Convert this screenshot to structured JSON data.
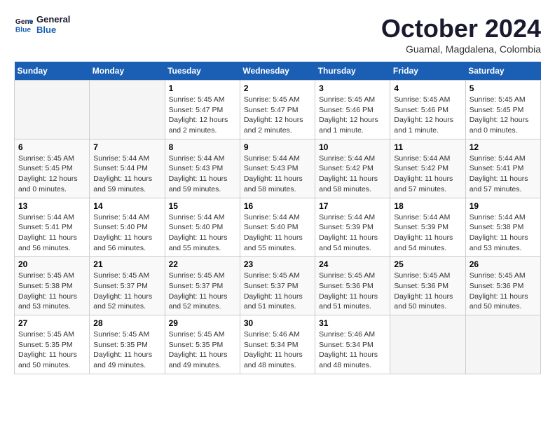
{
  "logo": {
    "line1": "General",
    "line2": "Blue"
  },
  "title": "October 2024",
  "location": "Guamal, Magdalena, Colombia",
  "days_of_week": [
    "Sunday",
    "Monday",
    "Tuesday",
    "Wednesday",
    "Thursday",
    "Friday",
    "Saturday"
  ],
  "weeks": [
    [
      {
        "day": "",
        "info": ""
      },
      {
        "day": "",
        "info": ""
      },
      {
        "day": "1",
        "info": "Sunrise: 5:45 AM\nSunset: 5:47 PM\nDaylight: 12 hours\nand 2 minutes."
      },
      {
        "day": "2",
        "info": "Sunrise: 5:45 AM\nSunset: 5:47 PM\nDaylight: 12 hours\nand 2 minutes."
      },
      {
        "day": "3",
        "info": "Sunrise: 5:45 AM\nSunset: 5:46 PM\nDaylight: 12 hours\nand 1 minute."
      },
      {
        "day": "4",
        "info": "Sunrise: 5:45 AM\nSunset: 5:46 PM\nDaylight: 12 hours\nand 1 minute."
      },
      {
        "day": "5",
        "info": "Sunrise: 5:45 AM\nSunset: 5:45 PM\nDaylight: 12 hours\nand 0 minutes."
      }
    ],
    [
      {
        "day": "6",
        "info": "Sunrise: 5:45 AM\nSunset: 5:45 PM\nDaylight: 12 hours\nand 0 minutes."
      },
      {
        "day": "7",
        "info": "Sunrise: 5:44 AM\nSunset: 5:44 PM\nDaylight: 11 hours\nand 59 minutes."
      },
      {
        "day": "8",
        "info": "Sunrise: 5:44 AM\nSunset: 5:43 PM\nDaylight: 11 hours\nand 59 minutes."
      },
      {
        "day": "9",
        "info": "Sunrise: 5:44 AM\nSunset: 5:43 PM\nDaylight: 11 hours\nand 58 minutes."
      },
      {
        "day": "10",
        "info": "Sunrise: 5:44 AM\nSunset: 5:42 PM\nDaylight: 11 hours\nand 58 minutes."
      },
      {
        "day": "11",
        "info": "Sunrise: 5:44 AM\nSunset: 5:42 PM\nDaylight: 11 hours\nand 57 minutes."
      },
      {
        "day": "12",
        "info": "Sunrise: 5:44 AM\nSunset: 5:41 PM\nDaylight: 11 hours\nand 57 minutes."
      }
    ],
    [
      {
        "day": "13",
        "info": "Sunrise: 5:44 AM\nSunset: 5:41 PM\nDaylight: 11 hours\nand 56 minutes."
      },
      {
        "day": "14",
        "info": "Sunrise: 5:44 AM\nSunset: 5:40 PM\nDaylight: 11 hours\nand 56 minutes."
      },
      {
        "day": "15",
        "info": "Sunrise: 5:44 AM\nSunset: 5:40 PM\nDaylight: 11 hours\nand 55 minutes."
      },
      {
        "day": "16",
        "info": "Sunrise: 5:44 AM\nSunset: 5:40 PM\nDaylight: 11 hours\nand 55 minutes."
      },
      {
        "day": "17",
        "info": "Sunrise: 5:44 AM\nSunset: 5:39 PM\nDaylight: 11 hours\nand 54 minutes."
      },
      {
        "day": "18",
        "info": "Sunrise: 5:44 AM\nSunset: 5:39 PM\nDaylight: 11 hours\nand 54 minutes."
      },
      {
        "day": "19",
        "info": "Sunrise: 5:44 AM\nSunset: 5:38 PM\nDaylight: 11 hours\nand 53 minutes."
      }
    ],
    [
      {
        "day": "20",
        "info": "Sunrise: 5:45 AM\nSunset: 5:38 PM\nDaylight: 11 hours\nand 53 minutes."
      },
      {
        "day": "21",
        "info": "Sunrise: 5:45 AM\nSunset: 5:37 PM\nDaylight: 11 hours\nand 52 minutes."
      },
      {
        "day": "22",
        "info": "Sunrise: 5:45 AM\nSunset: 5:37 PM\nDaylight: 11 hours\nand 52 minutes."
      },
      {
        "day": "23",
        "info": "Sunrise: 5:45 AM\nSunset: 5:37 PM\nDaylight: 11 hours\nand 51 minutes."
      },
      {
        "day": "24",
        "info": "Sunrise: 5:45 AM\nSunset: 5:36 PM\nDaylight: 11 hours\nand 51 minutes."
      },
      {
        "day": "25",
        "info": "Sunrise: 5:45 AM\nSunset: 5:36 PM\nDaylight: 11 hours\nand 50 minutes."
      },
      {
        "day": "26",
        "info": "Sunrise: 5:45 AM\nSunset: 5:36 PM\nDaylight: 11 hours\nand 50 minutes."
      }
    ],
    [
      {
        "day": "27",
        "info": "Sunrise: 5:45 AM\nSunset: 5:35 PM\nDaylight: 11 hours\nand 50 minutes."
      },
      {
        "day": "28",
        "info": "Sunrise: 5:45 AM\nSunset: 5:35 PM\nDaylight: 11 hours\nand 49 minutes."
      },
      {
        "day": "29",
        "info": "Sunrise: 5:45 AM\nSunset: 5:35 PM\nDaylight: 11 hours\nand 49 minutes."
      },
      {
        "day": "30",
        "info": "Sunrise: 5:46 AM\nSunset: 5:34 PM\nDaylight: 11 hours\nand 48 minutes."
      },
      {
        "day": "31",
        "info": "Sunrise: 5:46 AM\nSunset: 5:34 PM\nDaylight: 11 hours\nand 48 minutes."
      },
      {
        "day": "",
        "info": ""
      },
      {
        "day": "",
        "info": ""
      }
    ]
  ]
}
